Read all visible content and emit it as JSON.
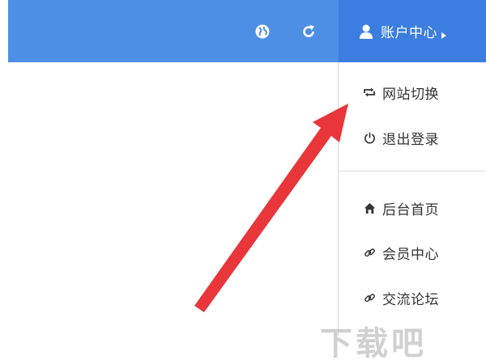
{
  "header": {
    "account_label": "账户中心",
    "icons": [
      "globe-icon",
      "refresh-icon",
      "user-icon",
      "caret-right-icon"
    ]
  },
  "dropdown": {
    "items": [
      {
        "label": "网站切换",
        "icon": "switch-icon"
      },
      {
        "label": "退出登录",
        "icon": "power-icon"
      },
      {
        "label": "后台首页",
        "icon": "home-icon"
      },
      {
        "label": "会员中心",
        "icon": "link-icon"
      },
      {
        "label": "交流论坛",
        "icon": "link-icon"
      }
    ]
  },
  "watermark": "下载吧",
  "colors": {
    "header_bg": "#4e8fe6",
    "account_bg": "#3b7ee0",
    "arrow": "#e8363a"
  }
}
